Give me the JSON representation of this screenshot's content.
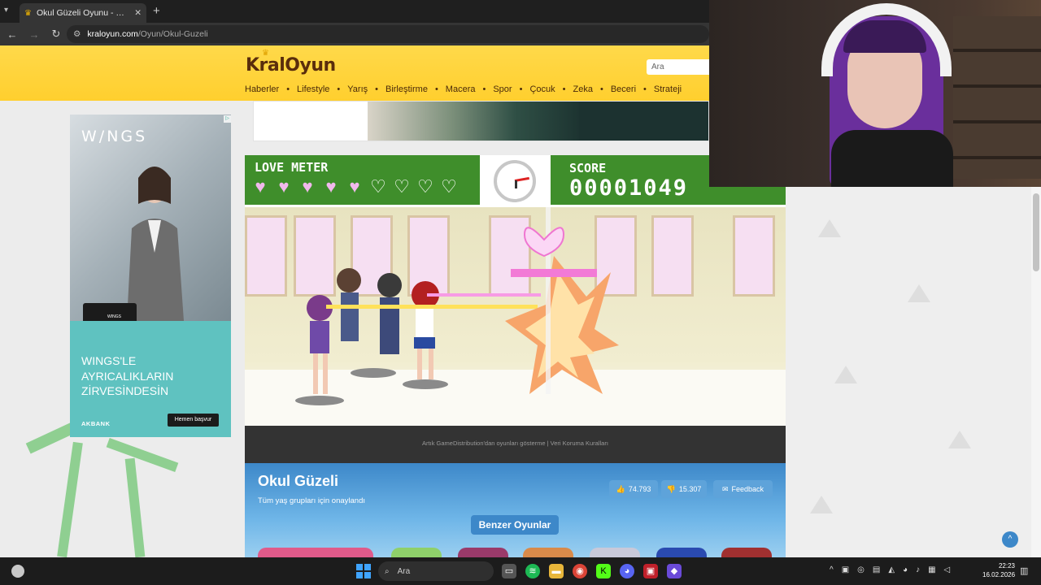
{
  "browser": {
    "tab_title": "Okul Güzeli Oyunu - Online üc",
    "url_domain": "kraloyun.com",
    "url_path": "/Oyun/Okul-Guzeli"
  },
  "site": {
    "logo": "KralOyun",
    "search_placeholder": "Ara",
    "categories": [
      "Haberler",
      "Lifestyle",
      "Yarış",
      "Birleştirme",
      "Macera",
      "Spor",
      "Çocuk",
      "Zeka",
      "Beceri",
      "Strateji"
    ]
  },
  "side_ad": {
    "brand": "W/NGS",
    "card_label": "WINGS",
    "headline": "WINGS'LE AYRICALIKLARIN ZİRVESİNDESİN",
    "bank": "AKBANK",
    "cta": "Hemen başvur"
  },
  "game": {
    "love_meter_label": "LOVE METER",
    "hearts_filled": 5,
    "hearts_total": 9,
    "score_label": "SCORE",
    "score_value": "00001049",
    "footer_text": "Artık GameDistribution'dan oyunları gösterme | Veri Koruma Kuralları"
  },
  "game_info": {
    "title": "Okul Güzeli",
    "subtitle": "Tüm yaş grupları için onaylandı",
    "likes": "74.793",
    "dislikes": "15.307",
    "feedback": "Feedback",
    "similar": "Benzer Oyunlar"
  },
  "taskbar": {
    "search": "Ara",
    "time": "22:23",
    "date": "16.02.2026"
  }
}
